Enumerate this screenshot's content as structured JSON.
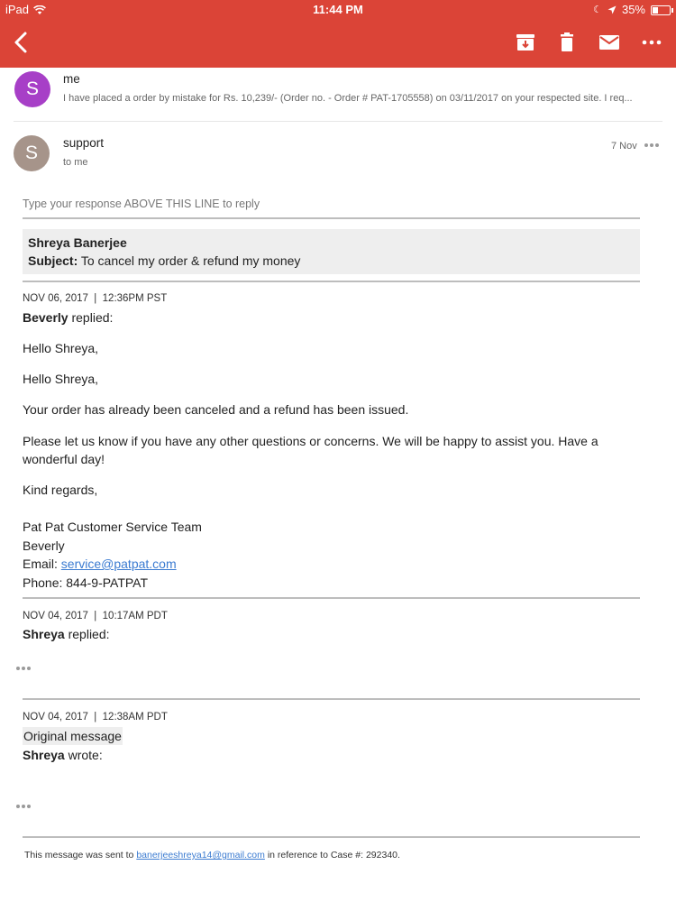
{
  "status_bar": {
    "device": "iPad",
    "time": "11:44 PM",
    "battery": "35%",
    "battery_level": 0.35
  },
  "toolbar": {
    "icons": [
      "back-arrow-icon",
      "archive-icon",
      "trash-icon",
      "mail-icon",
      "more-icon"
    ]
  },
  "colors": {
    "header": "#db4437",
    "avatar_me": "#a73fc7",
    "avatar_support": "#a6948a",
    "link": "#3b7bd1"
  },
  "thread": {
    "me": {
      "avatar": "S",
      "name": "me",
      "snippet": "I have placed a order by mistake for Rs. 10,239/- (Order no. - Order # PAT-1705558) on 03/11/2017 on your respected site. I req..."
    },
    "support": {
      "avatar": "S",
      "name": "support",
      "to": "to me",
      "date": "7 Nov"
    }
  },
  "email": {
    "reply_line": "Type your response ABOVE THIS LINE to reply",
    "customer_name": "Shreya Banerjee",
    "subject_label": "Subject:",
    "subject": "To cancel my order & refund my money",
    "reply1": {
      "meta": "NOV 06, 2017  |  12:36PM PST",
      "author": "Beverly",
      "action": "replied:",
      "greeting1": "Hello Shreya,",
      "greeting2": "Hello Shreya,",
      "para1": "Your order has already been canceled and a refund has been issued.",
      "para2_line1": "Please let us know if you have any other questions or concerns. We will be happy to assist you. Have a",
      "para2_line2": "wonderful day!",
      "closing": "Kind regards,",
      "team": "Pat Pat Customer Service Team",
      "sig_name": "Beverly",
      "email_label": "Email:",
      "email": "service@patpat.com",
      "phone": "Phone: 844-9-PATPAT"
    },
    "reply2": {
      "meta": "NOV 04, 2017  |  10:17AM PDT",
      "author": "Shreya",
      "action": "replied:"
    },
    "reply3": {
      "meta": "NOV 04, 2017  |  12:38AM PDT",
      "original": "Original message",
      "author": "Shreya",
      "action": "wrote:"
    },
    "footer": {
      "prefix": "This message was sent to",
      "address": "banerjeeshreya14@gmail.com",
      "suffix": "in reference to Case #: 292340."
    }
  }
}
